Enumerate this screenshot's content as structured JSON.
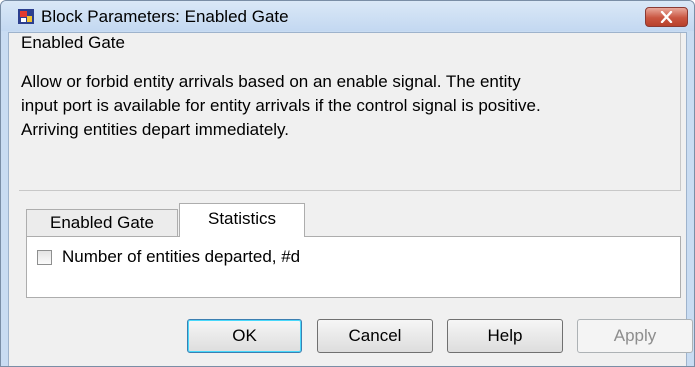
{
  "window": {
    "title": "Block Parameters: Enabled Gate",
    "close_icon": "close-icon"
  },
  "group": {
    "title": "Enabled Gate",
    "description_lines": [
      "Allow or forbid entity arrivals based on an enable signal. The entity",
      "input port is available for entity arrivals if the control signal is positive.",
      "Arriving entities depart immediately."
    ]
  },
  "tabs": [
    {
      "label": "Enabled Gate",
      "active": false
    },
    {
      "label": "Statistics",
      "active": true
    }
  ],
  "statistics": {
    "checkbox_label": "Number of entities departed, #d",
    "checked": false
  },
  "buttons": {
    "ok": "OK",
    "cancel": "Cancel",
    "help": "Help",
    "apply": "Apply"
  },
  "colors": {
    "close_button": "#c95540",
    "window_frame": "#c9dcf2"
  }
}
